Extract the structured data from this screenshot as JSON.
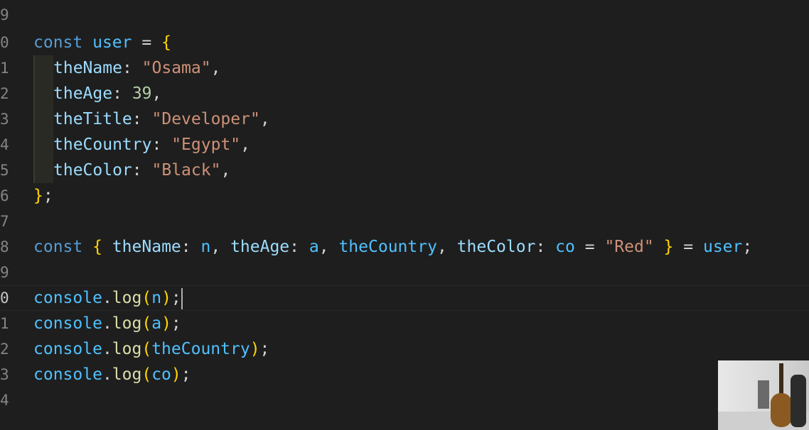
{
  "editor": {
    "gutter": {
      "line_numbers": [
        "9",
        "0",
        "1",
        "2",
        "3",
        "4",
        "5",
        "6",
        "7",
        "8",
        "9",
        "0",
        "1",
        "2",
        "3",
        "4"
      ],
      "active_line_index": 11
    },
    "code": {
      "l10_kw": "const",
      "l10_var": "user",
      "l10_eq": "=",
      "l10_brace": "{",
      "l11_prop": "theName",
      "l11_val": "\"Osama\"",
      "l12_prop": "theAge",
      "l12_val": "39",
      "l13_prop": "theTitle",
      "l13_val": "\"Developer\"",
      "l14_prop": "theCountry",
      "l14_val": "\"Egypt\"",
      "l15_prop": "theColor",
      "l15_val": "\"Black\"",
      "l16_close": "}",
      "l16_semi": ";",
      "l18_kw": "const",
      "l18_open": "{",
      "l18_p1": "theName",
      "l18_v1": "n",
      "l18_p2": "theAge",
      "l18_v2": "a",
      "l18_p3": "theCountry",
      "l18_p4": "theColor",
      "l18_v4": "co",
      "l18_default": "\"Red\"",
      "l18_close": "}",
      "l18_user": "user",
      "console_obj": "console",
      "log_fn": "log",
      "arg1": "n",
      "arg2": "a",
      "arg3": "theCountry",
      "arg4": "co"
    }
  },
  "colors": {
    "background": "#1e1e1e",
    "keyword": "#569cd6",
    "variable": "#4fc1ff",
    "property": "#9cdcfe",
    "string": "#ce9178",
    "number": "#b5cea8",
    "function": "#dcdcaa",
    "bracket": "#ffd700"
  }
}
